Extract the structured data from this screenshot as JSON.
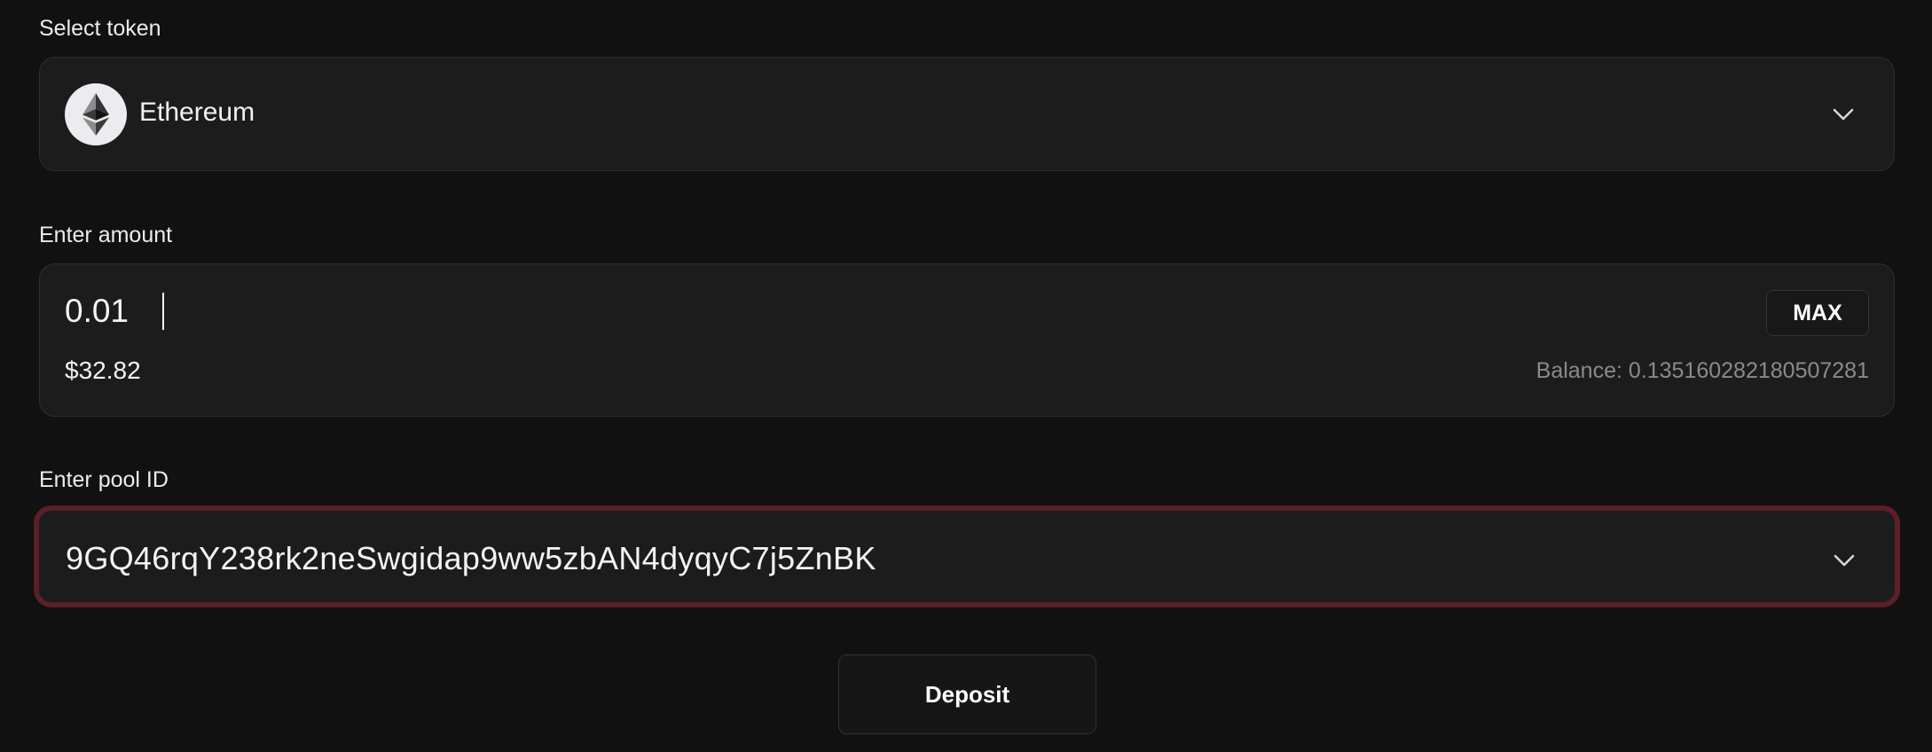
{
  "token": {
    "label": "Select token",
    "selected": "Ethereum",
    "icon": "ethereum-icon",
    "dropdown_icon": "chevron-down-icon"
  },
  "amount": {
    "label": "Enter amount",
    "value": "0.01",
    "usd_value": "$32.82",
    "max_label": "MAX",
    "balance": "Balance: 0.135160282180507281"
  },
  "pool": {
    "label": "Enter pool ID",
    "value": "9GQ46rqY238rk2neSwgidap9ww5zbAN4dyqyC7j5ZnBK",
    "dropdown_icon": "chevron-down-icon",
    "error_border_color": "#5a1f27"
  },
  "actions": {
    "deposit_label": "Deposit"
  }
}
